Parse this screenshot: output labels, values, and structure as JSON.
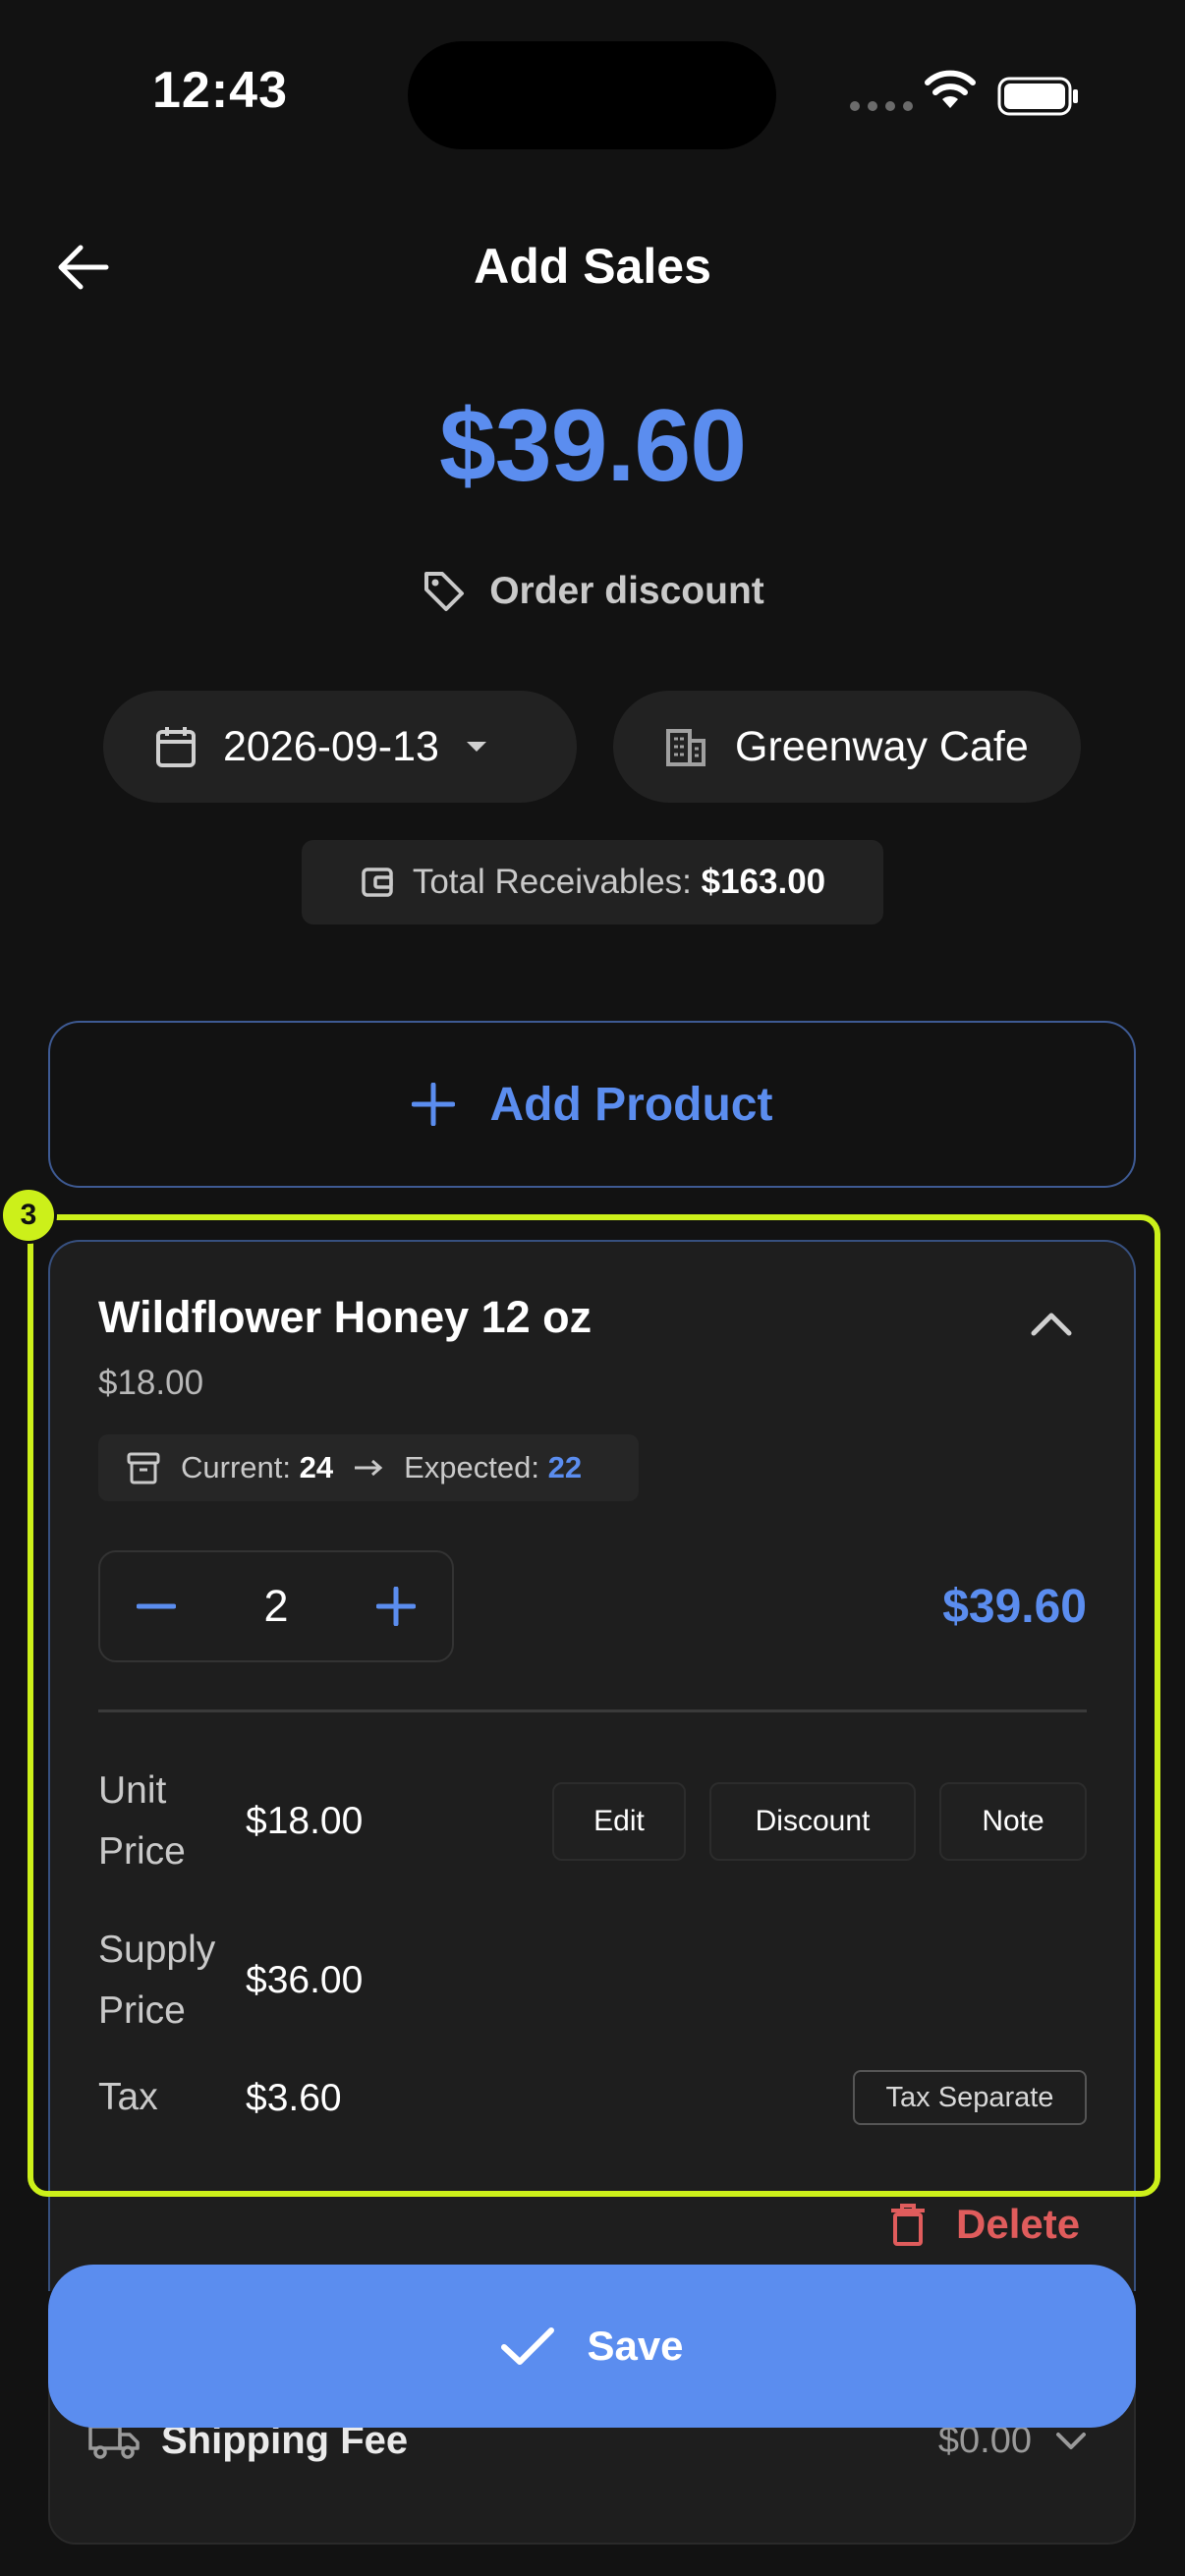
{
  "status_bar": {
    "time": "12:43"
  },
  "header": {
    "title": "Add Sales"
  },
  "summary": {
    "total": "$39.60",
    "order_discount_label": "Order discount",
    "date": "2026-09-13",
    "customer": "Greenway Cafe",
    "receivables_label": "Total Receivables:",
    "receivables_value": "$163.00"
  },
  "add_product_label": "Add Product",
  "product": {
    "name": "Wildflower Honey 12 oz",
    "price": "$18.00",
    "current_label": "Current:",
    "current_value": "24",
    "expected_label": "Expected:",
    "expected_value": "22",
    "quantity": "2",
    "line_total": "$39.60",
    "unit_price_label": "Unit Price",
    "unit_price_value": "$18.00",
    "supply_price_label": "Supply Price",
    "supply_price_value": "$36.00",
    "tax_label": "Tax",
    "tax_value": "$3.60",
    "edit_label": "Edit",
    "discount_label": "Discount",
    "note_label": "Note",
    "tax_badge": "Tax Separate",
    "delete_label": "Delete"
  },
  "highlight": {
    "number": "3",
    "color": "#ccf01a"
  },
  "shipping": {
    "label": "Shipping Fee",
    "value": "$0.00"
  },
  "save_label": "Save",
  "colors": {
    "accent": "#5b8def",
    "danger": "#e05c5c",
    "background": "#121212"
  }
}
